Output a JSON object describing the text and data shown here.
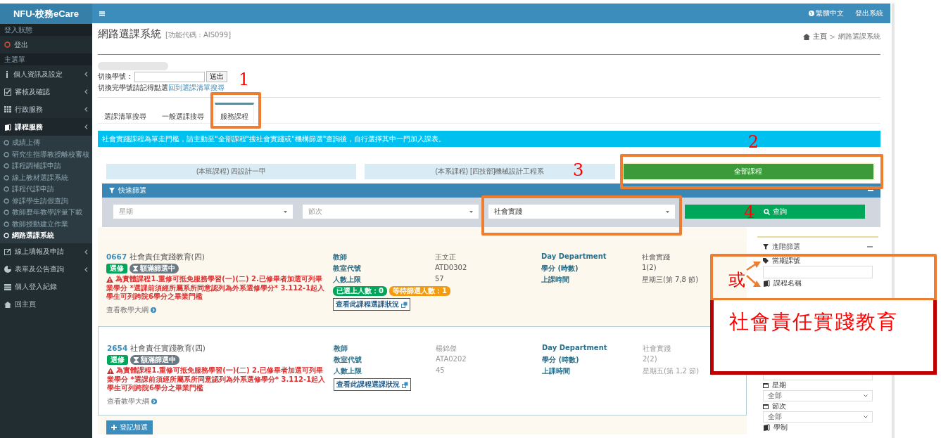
{
  "sidebar": {
    "logo": "NFU-校務eCare",
    "sections": [
      {
        "heading": "登入狀態",
        "items": [
          {
            "label": "登出",
            "kind": "logout"
          }
        ]
      },
      {
        "heading": "主選單",
        "items": [
          {
            "label": "個人資訊及設定",
            "kind": "menu",
            "submenu": true,
            "expanded": false
          },
          {
            "label": "審核及確認",
            "kind": "menu",
            "submenu": true,
            "expanded": false
          },
          {
            "label": "行政服務",
            "kind": "menu",
            "submenu": true,
            "expanded": false
          },
          {
            "label": "課程服務",
            "kind": "menu",
            "submenu": true,
            "expanded": true,
            "children": [
              {
                "label": "成績上傳",
                "selected": false
              },
              {
                "label": "研究生指導教授離校審核",
                "selected": false
              },
              {
                "label": "課程調補課申請",
                "selected": false
              },
              {
                "label": "線上教材選課系統",
                "selected": false
              },
              {
                "label": "課程代課申請",
                "selected": false
              },
              {
                "label": "修課學生請假查詢",
                "selected": false
              },
              {
                "label": "教師歷年教學評量下載",
                "selected": false
              },
              {
                "label": "教師授動建立作業",
                "selected": false
              },
              {
                "label": "網路選課系統",
                "selected": true
              }
            ]
          },
          {
            "label": "線上填報及申請",
            "kind": "menu",
            "submenu": true,
            "expanded": false
          },
          {
            "label": "表單及公告查詢",
            "kind": "menu",
            "submenu": true,
            "expanded": false
          },
          {
            "label": "個人登入紀錄",
            "kind": "menu",
            "submenu": false,
            "expanded": false
          },
          {
            "label": "回主頁",
            "kind": "menu",
            "submenu": false,
            "expanded": false
          }
        ]
      }
    ]
  },
  "top_bar": {
    "language": "繁體中文",
    "logout": "登出系統"
  },
  "page": {
    "title": "網路選課系統",
    "code": "[功能代碼：AIS099]",
    "breadcrumb": [
      "主頁",
      "網路選課系統"
    ],
    "separator": ">"
  },
  "switch_form": {
    "label": "切換學號：",
    "button": "送出",
    "hint": "切換完學號請記得點選",
    "hint_link": "回到選課清單搜尋"
  },
  "tabs": [
    {
      "label": "選課清單搜尋",
      "selected": false
    },
    {
      "label": "一般選課搜尋",
      "selected": false
    },
    {
      "label": "服務課程",
      "selected": true
    }
  ],
  "notice": "社會實踐課程為單走門檻，請主動至\"全部課程\"搜社會實踐或\"機構篩選\"查詢後，自行選擇其中一門加入課表。",
  "scope_buttons": [
    {
      "label": "(本班課程) 四設計一甲",
      "selected": false
    },
    {
      "label": "(本系課程) [四技部]機械設計工程系",
      "selected": false
    },
    {
      "label": "全部課程",
      "selected": true
    }
  ],
  "quick_filter": {
    "title": "快速篩選",
    "selects": [
      {
        "placeholder": "星期"
      },
      {
        "placeholder": "節次"
      },
      {
        "value": "社會實踐"
      }
    ],
    "button": "查詢"
  },
  "courses": [
    {
      "code": "0667",
      "name": "社會責任實踐教育(四)",
      "badges": [
        "選修",
        "額滿篩選中"
      ],
      "warning": "為實體課程1.重修可抵免服務學習(一)(二) 2.已修畢者加選可列畢業學分 *選課前須經所屬系所同意認列為外系選修學分* 3.112-1起入學生可列跨院6學分之畢業門檻",
      "syllabus": "查看教學大綱",
      "fields": [
        [
          "教師",
          "王文正"
        ],
        [
          "教室代號",
          "ATD0302"
        ],
        [
          "人數上限",
          "57"
        ]
      ],
      "fields2": [
        [
          "Day Department",
          "社會實踐"
        ],
        [
          "學分 (時數)",
          "1(2)"
        ],
        [
          "上課時間",
          "星期三(第 7,8 節)"
        ]
      ],
      "counts": [
        {
          "text": "已選上人數：0",
          "color": "#00a65a"
        },
        {
          "text": "等待篩選人數：1",
          "color": "#f39c12"
        }
      ],
      "status_button": "查看此課程選課狀況",
      "selected": true
    },
    {
      "code": "2654",
      "name": "社會責任實踐教育(四)",
      "badges": [
        "選修",
        "額滿篩選中"
      ],
      "warning": "為實體課程1.重修可抵免服務學習(一)(二) 2.已修畢者加選可列畢業學分 *選課前須經所屬系所同意認列為外系選修學分* 3.112-1起入學生可列跨院6學分之畢業門檻",
      "syllabus": "查看教學大綱",
      "fields": [
        [
          "教師",
          "楊錦傑"
        ],
        [
          "教室代號",
          "ATA0202"
        ],
        [
          "人數上限",
          "45"
        ]
      ],
      "fields2": [
        [
          "Day Department",
          "社會實踐"
        ],
        [
          "學分 (時數)",
          "2(2)"
        ],
        [
          "上課時間",
          "星期五(第 1,2 節)"
        ]
      ],
      "status_button": "查看此課程選課狀況",
      "selected": false
    }
  ],
  "add_button": "登記加選",
  "advanced_filter": {
    "title": "進階篩選",
    "fields": [
      {
        "label": "當期課號",
        "kind": "input"
      },
      {
        "label": "課程名稱",
        "kind": "hidden"
      },
      {
        "label": "星期",
        "kind": "select",
        "value": "全部"
      },
      {
        "label": "節次",
        "kind": "select",
        "value": "全部"
      },
      {
        "label": "學制",
        "kind": "label"
      }
    ]
  },
  "annotations": [
    {
      "kind": "frame",
      "color": "#ed7d31"
    },
    {
      "kind": "number",
      "text": "1"
    },
    {
      "kind": "frame",
      "color": "#ed7d31"
    },
    {
      "kind": "number",
      "text": "2"
    },
    {
      "kind": "frame",
      "color": "#ed7d31"
    },
    {
      "kind": "number",
      "text": "3"
    },
    {
      "kind": "number",
      "text": "4"
    },
    {
      "kind": "frame",
      "color": "#ed7d31"
    },
    {
      "kind": "label",
      "text": "或"
    },
    {
      "kind": "arrows"
    },
    {
      "kind": "note",
      "text": "社會責任實踐教育",
      "color": "#c00000"
    }
  ]
}
